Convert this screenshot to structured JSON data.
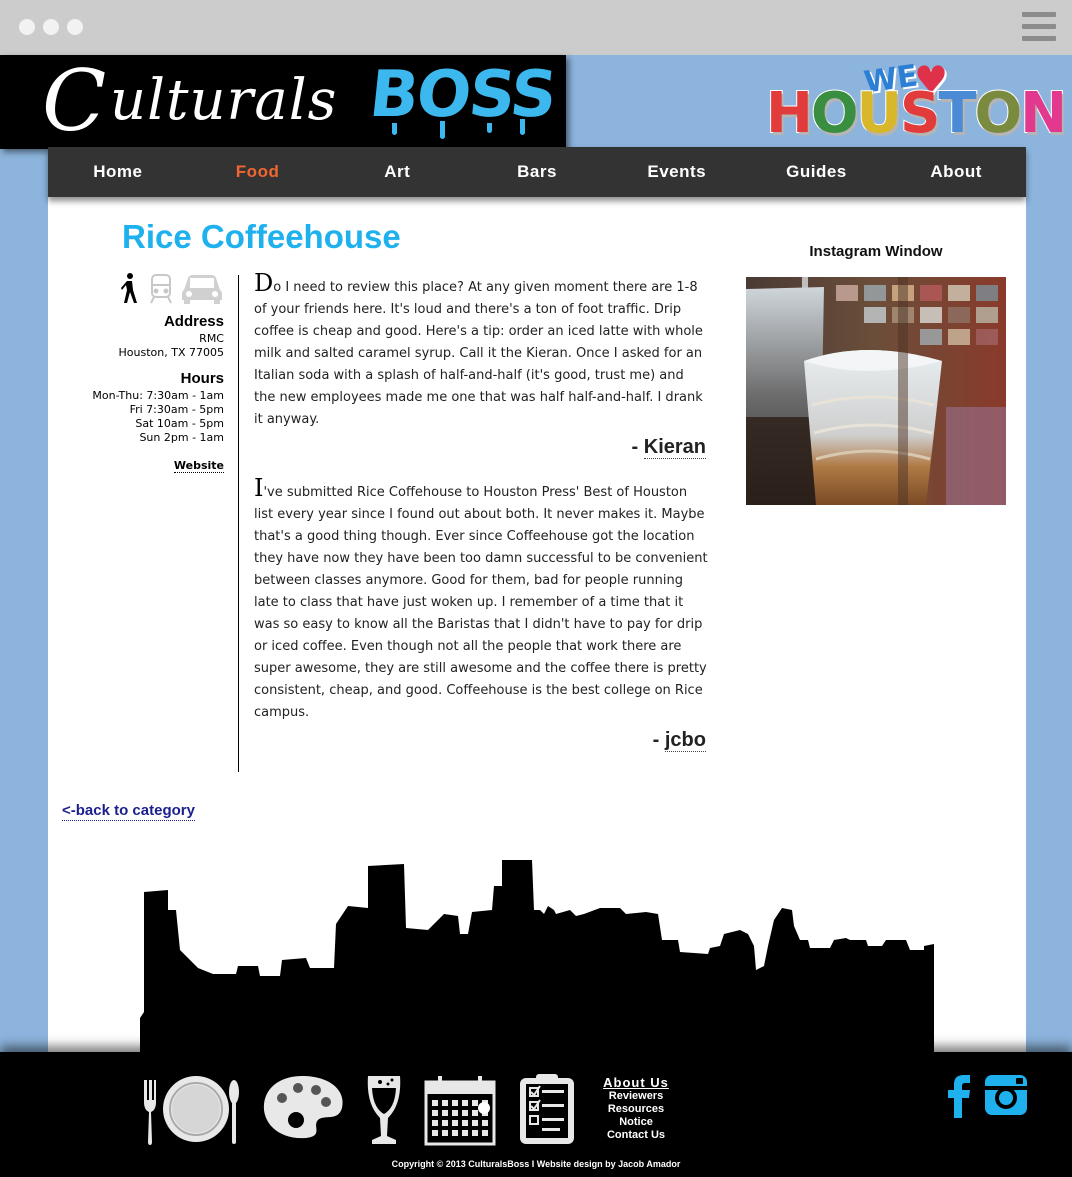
{
  "brand": {
    "logo_c": "C",
    "logo_script": "ulturals",
    "logo_boss": "BOSS",
    "we": "WE",
    "houston": [
      "H",
      "O",
      "U",
      "S",
      "T",
      "O",
      "N"
    ],
    "houston_colors": [
      "#e23b3b",
      "#3a8e3f",
      "#d8b72b",
      "#e23b3b",
      "#4b8bd6",
      "#7a8a3e",
      "#e2398f"
    ]
  },
  "nav": {
    "items": [
      {
        "label": "Home"
      },
      {
        "label": "Food",
        "active": true
      },
      {
        "label": "Art"
      },
      {
        "label": "Bars"
      },
      {
        "label": "Events"
      },
      {
        "label": "Guides"
      },
      {
        "label": "About"
      }
    ]
  },
  "page": {
    "title": "Rice Coffeehouse",
    "address_heading": "Address",
    "address_lines": [
      "RMC",
      "Houston, TX 77005"
    ],
    "hours_heading": "Hours",
    "hours_lines": [
      "Mon-Thu: 7:30am - 1am",
      "Fri 7:30am - 5pm",
      "Sat 10am - 5pm",
      "Sun 2pm - 1am"
    ],
    "website_link": "Website",
    "transport_icons": [
      "walking-icon",
      "train-icon",
      "car-icon"
    ],
    "back_link": "<-back to category"
  },
  "reviews": [
    {
      "dropcap": "D",
      "text": "o I need to review this place? At any given moment there are 1-8 of your friends here. It's loud and there's a ton of foot traffic. Drip coffee is cheap and good. Here's a tip: order an iced latte with whole milk and salted caramel syrup. Call it the Kieran. Once I asked for an Italian soda with a splash of half-and-half (it's good, trust me) and the new employees made me one that was half half-and-half. I drank it anyway.",
      "sig_prefix": "- ",
      "author": "Kieran"
    },
    {
      "dropcap": "I",
      "text": "'ve submitted Rice Coffehouse to Houston Press' Best of Houston list every year since I found out about both. It never makes it. Maybe that's a good thing though. Ever since Coffeehouse got the location they have now they have been too damn successful to be convenient between classes anymore. Good for them, bad for people running late to class that have just woken up. I remember of a time that it was so easy to know all the Baristas that I didn't have to pay for drip or iced coffee. Even though not all the people that work there are super awesome, they are still awesome and the coffee there is pretty consistent, cheap, and good. Coffeehouse is the best college on Rice campus.",
      "sig_prefix": "- ",
      "author": "jcbo"
    }
  ],
  "instagram": {
    "title": "Instagram Window"
  },
  "footer": {
    "icons": [
      "plate-icon",
      "palette-icon",
      "glass-icon",
      "calendar-icon",
      "checklist-icon"
    ],
    "about": "About Us",
    "links": [
      "Reviewers",
      "Resources",
      "Notice",
      "Contact Us"
    ],
    "copyright": "Copyright © 2013 CulturalsBoss I Website design by Jacob Amador",
    "social": [
      "facebook-icon",
      "instagram-icon"
    ],
    "social_color": "#1fb1ee"
  },
  "colors": {
    "accent": "#1fb1ee",
    "nav_active": "#f26531",
    "nav_bg": "#333333",
    "page_bg": "#8cb4dc"
  }
}
